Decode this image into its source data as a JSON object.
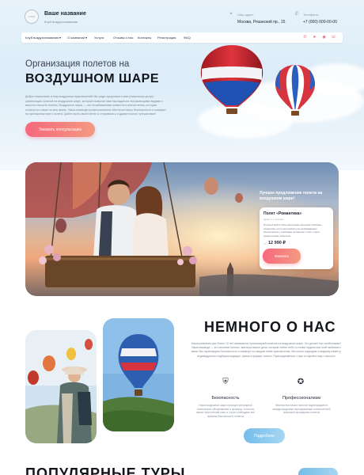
{
  "header": {
    "logo_text": "LOGO",
    "brand_name": "Ваше название",
    "brand_sub": "Клуб воздухоплавания",
    "address_label": "Наш адрес",
    "address_value": "Москва, Рязанский пр., 15",
    "phone_label": "Телефоны",
    "phone_value": "+7 (000) 000-00-00"
  },
  "nav": {
    "items": [
      "Клуб воздухоплавания",
      "О компании",
      "Услуги",
      "Отзывы о нас",
      "Контакты",
      "Регистрация",
      "ФАQ"
    ],
    "social_icons": [
      "phone-icon",
      "telegram-icon",
      "whatsapp-icon",
      "viber-icon"
    ]
  },
  "hero": {
    "subtitle": "Организация полетов на",
    "title": "ВОЗДУШНОМ ШАРЕ",
    "text": "Добро пожаловать в мир воздушных приключений! Мы рады предложить вам уникальную услугу организации полетов на воздушном шаре, которые позволят вам насладиться потрясающими видами с высоты птичьего полета. Воздушные шары — это незабываемые моменты и впечатления, которые останутся с вами на всю жизнь. Наша команда профессионалов обеспечит вашу безопасность и комфорт на протяжении всего полета. Дайте волю своей мечте и отправьтесь в удивительное путешествие!",
    "button": "Заказать консультацию"
  },
  "offer": {
    "heading": "Лучшее предложение полета на воздушном шаре!",
    "name": "Полет «Романтика»",
    "subname": "Цена от 1 человек",
    "description": "Путешествуйте себе настоящим персонам любимых романтика, нечто волшебного на незабываемых впечатлениях с любимым человеком, полет станет романтичным событием",
    "price_prefix": "от",
    "price": "12 990 ₽",
    "button": "Заказать"
  },
  "about": {
    "title": "НЕМНОГО О НАС",
    "text": "Наша компания уже более 10 лет занимается организацией полетов на воздушном шаре. Что делает нас особенными? Наша команда — это опытные пилоты, мастера своего дела, которые любят небо и готовы поделиться этой любовью с вами. Мы гарантируем безопасность и комфорт на каждом этапе приключения. Мы полно подходим к каждому клиенту, индивидуально подбирая маршрут, время и формат полета. Присоединяйтесь к нам и откройте мир с высоты!",
    "features": [
      {
        "icon": "shield-icon",
        "title": "Безопасность",
        "text": "Наши воздушные шары проходят регулярное техническое обслуживание и проверку, а пилоты имеют многолетний опыт и строго соблюдают все правила безопасности полетов"
      },
      {
        "icon": "award-icon",
        "title": "Профессионализм",
        "text": "Мастерство наших пилотов подтверждается международными сертификатами и многолетней практикой проведения полетов"
      }
    ],
    "button": "Подробнее"
  },
  "tours": {
    "title": "ПОПУЛЯРНЫЕ ТУРЫ"
  },
  "colors": {
    "accent": "#f7687c",
    "accent_light": "#f49a82",
    "blue": "#74bde9",
    "text_dark": "#12151c"
  }
}
